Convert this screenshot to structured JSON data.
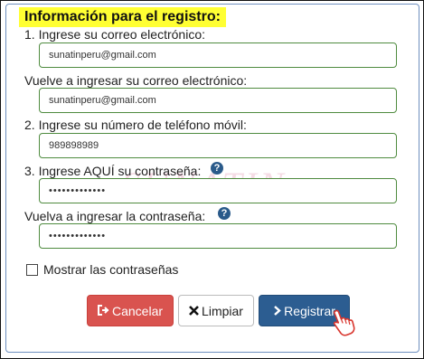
{
  "form": {
    "title": "Información para el registro:",
    "watermark": "SUNATIN",
    "fields": [
      {
        "label": "1. Ingrese su correo electrónico:",
        "value": "sunatinperu@gmail.com"
      },
      {
        "label": "Vuelve a ingresar su correo electrónico:",
        "value": "sunatinperu@gmail.com"
      },
      {
        "label": "2. Ingrese su número de teléfono móvil:",
        "value": "989898989"
      },
      {
        "label": "3. Ingrese AQUÍ su contraseña:",
        "value": "•••••••••••••"
      },
      {
        "label": "Vuelva a ingresar la contraseña:",
        "value": "•••••••••••••"
      }
    ],
    "help_glyph": "?",
    "show_passwords_label": "Mostrar las contraseñas",
    "show_passwords_checked": false,
    "buttons": {
      "cancel": {
        "icon": "sign-out-icon",
        "label": "Cancelar",
        "color": "#d9534f"
      },
      "clear": {
        "icon": "x-icon",
        "label": "Limpiar",
        "color": "#ffffff"
      },
      "register": {
        "icon": "chevron-right-icon",
        "label": "Registrar",
        "color": "#2c5d91"
      }
    },
    "colors": {
      "title_highlight": "#ffff33",
      "input_border": "#4f8b3f",
      "help_icon": "#2a5a8a"
    }
  }
}
